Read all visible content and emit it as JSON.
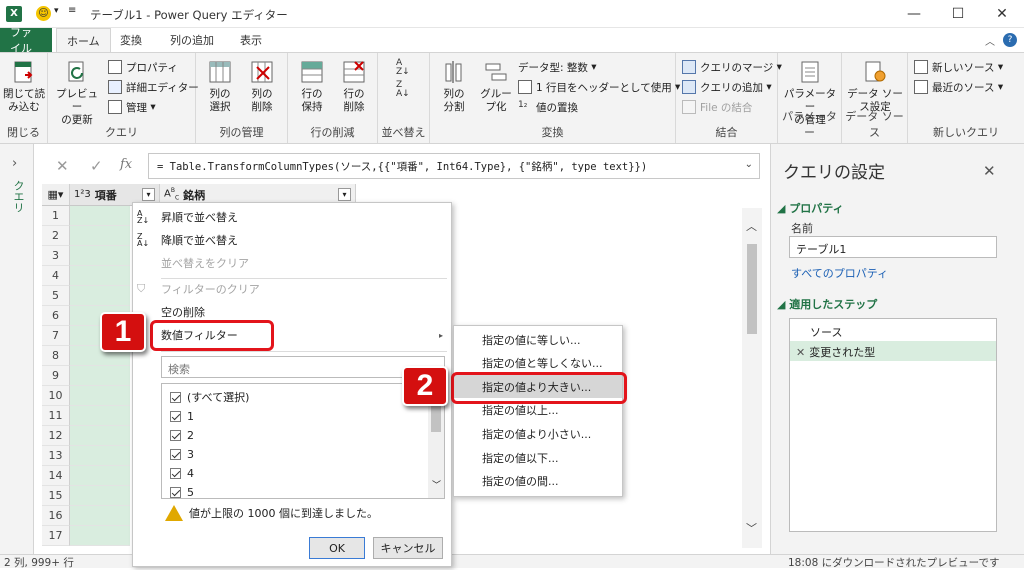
{
  "window": {
    "title": "テーブル1 - Power Query エディター"
  },
  "tabs": [
    "ファイル",
    "ホーム",
    "変換",
    "列の追加",
    "表示"
  ],
  "ribbon": {
    "close": {
      "btn": "閉じて読\nみ込む",
      "label": "閉じる"
    },
    "query": {
      "preview": "プレビュー\nの更新",
      "properties": "プロパティ",
      "advanced": "詳細エディター",
      "manage": "管理",
      "label": "クエリ"
    },
    "columns": {
      "select": "列の\n選択",
      "remove": "列の\n削除",
      "label": "列の管理"
    },
    "rows": {
      "keep": "行の\n保持",
      "remove": "行の\n削除",
      "label": "行の削減"
    },
    "sort": {
      "label": "並べ替え"
    },
    "transform": {
      "split": "列の\n分割",
      "group": "グルー\nプ化",
      "datatype": "データ型: 整数",
      "header": "1 行目をヘッダーとして使用",
      "replace": "値の置換",
      "label": "変換"
    },
    "combine": {
      "merge": "クエリのマージ",
      "append": "クエリの追加",
      "files": "File の結合",
      "label": "結合"
    },
    "params": {
      "manage": "パラメーター\nの管理",
      "label": "パラメーター"
    },
    "datasource": {
      "settings": "データ ソー\nス設定",
      "label": "データ ソース"
    },
    "newquery": {
      "new": "新しいソース",
      "recent": "最近のソース",
      "label": "新しいクエリ"
    }
  },
  "leftnav": {
    "label": "クエリ"
  },
  "formula": {
    "fx": "fx",
    "text": "= Table.TransformColumnTypes(ソース,{{\"項番\", Int64.Type}, {\"銘柄\", type text}})"
  },
  "grid": {
    "columns": [
      {
        "type": "1²3",
        "name": "項番"
      },
      {
        "type": "A^B_C",
        "name": "銘柄"
      }
    ],
    "rows": [
      "1",
      "2",
      "3",
      "4",
      "5",
      "6",
      "7",
      "8",
      "9",
      "10",
      "11",
      "12",
      "13",
      "14",
      "15",
      "16",
      "17"
    ]
  },
  "menu": {
    "sort_asc": "昇順で並べ替え",
    "sort_desc": "降順で並べ替え",
    "clear_sort": "並べ替えをクリア",
    "clear_filter": "フィルターのクリア",
    "remove_empty": "空の削除",
    "number_filter": "数値フィルター",
    "search_placeholder": "検索",
    "checklist": [
      "(すべて選択)",
      "1",
      "2",
      "3",
      "4",
      "5"
    ],
    "warning": "値が上限の 1000 個に到達しました。",
    "ok": "OK",
    "cancel": "キャンセル"
  },
  "submenu": [
    "指定の値に等しい...",
    "指定の値と等しくない...",
    "指定の値より大きい...",
    "指定の値以上...",
    "指定の値より小さい...",
    "指定の値以下...",
    "指定の値の間..."
  ],
  "settings": {
    "title": "クエリの設定",
    "properties": "プロパティ",
    "name_label": "名前",
    "name_value": "テーブル1",
    "all_props": "すべてのプロパティ",
    "steps_title": "適用したステップ",
    "steps": [
      "ソース",
      "変更された型"
    ]
  },
  "status": {
    "left": "2 列, 999+ 行",
    "right": "18:08 にダウンロードされたプレビューです"
  },
  "badges": [
    "1",
    "2"
  ],
  "colors": {
    "excel_green": "#217346",
    "highlight_red": "#e3141b",
    "badge_red": "#d40f0f"
  }
}
